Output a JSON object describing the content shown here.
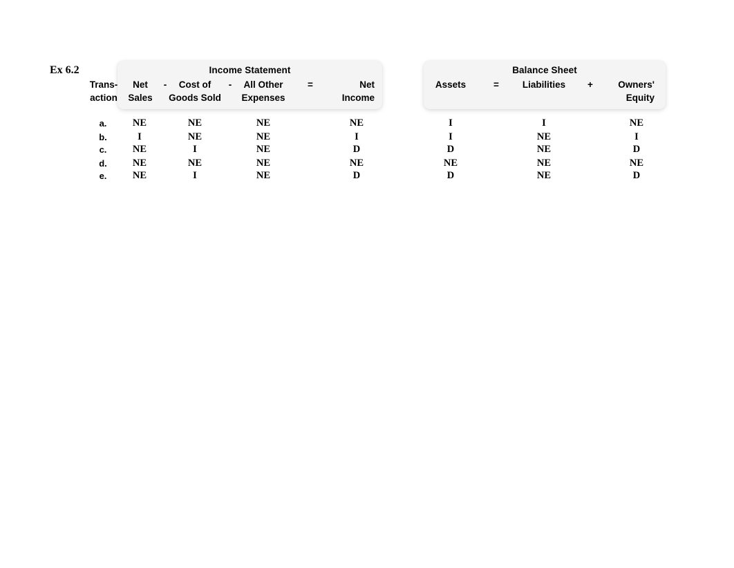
{
  "exercise": {
    "label": "Ex 6.2"
  },
  "income_statement": {
    "title": "Income Statement",
    "columns": [
      {
        "line1": "Trans-",
        "line2": "action"
      },
      {
        "line1": "Net",
        "line2": "Sales"
      },
      {
        "line1": "Cost of",
        "line2": "Goods Sold"
      },
      {
        "line1": "All Other",
        "line2": "Expenses"
      },
      {
        "line1": "Net",
        "line2": "Income"
      }
    ],
    "operators": [
      "-",
      "-",
      "="
    ]
  },
  "balance_sheet": {
    "title": "Balance Sheet",
    "columns": [
      {
        "line1": "Assets",
        "line2": ""
      },
      {
        "line1": "Liabilities",
        "line2": ""
      },
      {
        "line1": "Owners'",
        "line2": "Equity"
      }
    ],
    "operators": [
      "=",
      "+"
    ]
  },
  "rows": [
    {
      "label": "a.",
      "net_sales": "NE",
      "cost_of_goods_sold": "NE",
      "all_other_expenses": "NE",
      "net_income": "NE",
      "assets": "I",
      "liabilities": "I",
      "owners_equity": "NE"
    },
    {
      "label": "b.",
      "net_sales": "I",
      "cost_of_goods_sold": "NE",
      "all_other_expenses": "NE",
      "net_income": "I",
      "assets": "I",
      "liabilities": "NE",
      "owners_equity": "I"
    },
    {
      "label": "c.",
      "net_sales": "NE",
      "cost_of_goods_sold": "I",
      "all_other_expenses": "NE",
      "net_income": "D",
      "assets": "D",
      "liabilities": "NE",
      "owners_equity": "D"
    },
    {
      "label": "d.",
      "net_sales": "NE",
      "cost_of_goods_sold": "NE",
      "all_other_expenses": "NE",
      "net_income": "NE",
      "assets": "NE",
      "liabilities": "NE",
      "owners_equity": "NE"
    },
    {
      "label": "e.",
      "net_sales": "NE",
      "cost_of_goods_sold": "I",
      "all_other_expenses": "NE",
      "net_income": "D",
      "assets": "D",
      "liabilities": "NE",
      "owners_equity": "D"
    }
  ],
  "colors": {
    "page_background": "#ffffff",
    "header_block_background": "#f4f4f4",
    "text": "#000000"
  }
}
